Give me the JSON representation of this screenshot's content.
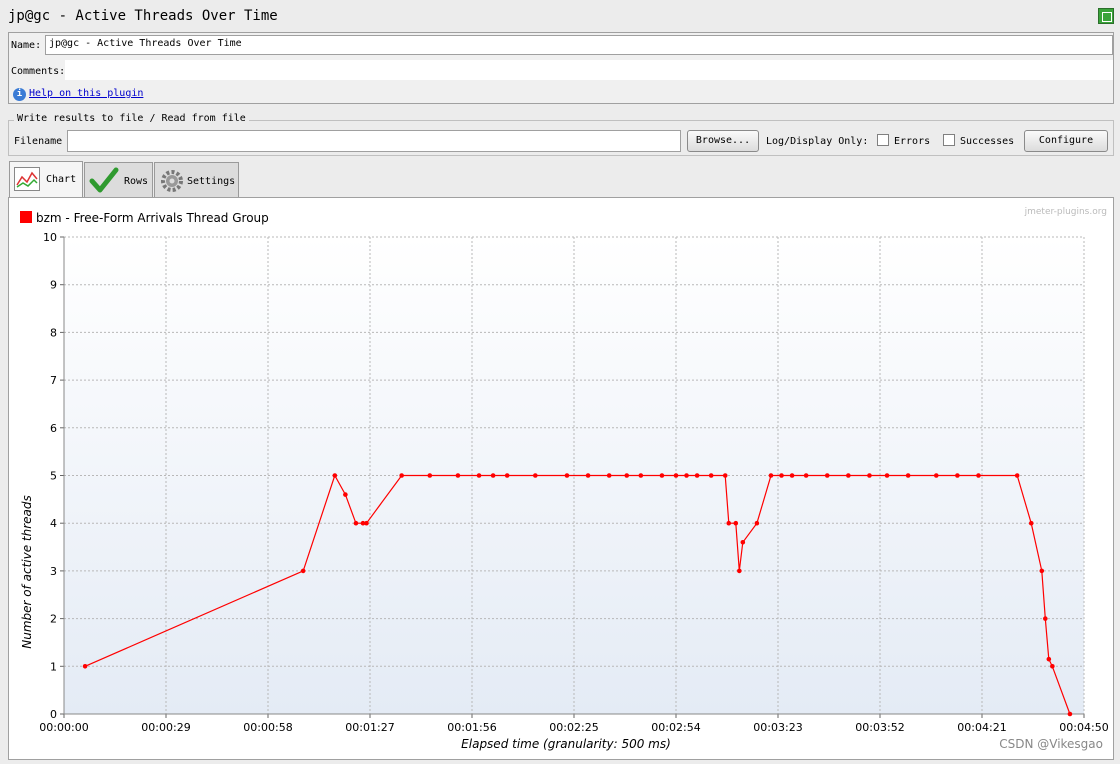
{
  "window": {
    "title": "jp@gc - Active Threads Over Time"
  },
  "form": {
    "name_label": "Name:",
    "name_value": "jp@gc - Active Threads Over Time",
    "comments_label": "Comments:",
    "comments_value": "",
    "help_link": "Help on this plugin"
  },
  "file": {
    "group_title": "Write results to file / Read from file",
    "filename_label": "Filename",
    "filename_value": "",
    "browse_button": "Browse...",
    "log_display_label": "Log/Display Only:",
    "errors_label": "Errors",
    "errors_checked": false,
    "successes_label": "Successes",
    "successes_checked": false,
    "configure_button": "Configure"
  },
  "tabs": [
    {
      "label": "Chart",
      "icon": "chart-icon",
      "active": true
    },
    {
      "label": "Rows",
      "icon": "checkmark-icon",
      "active": false
    },
    {
      "label": "Settings",
      "icon": "gear-icon",
      "active": false
    }
  ],
  "chart_data": {
    "type": "line",
    "legend_label": "bzm - Free-Form Arrivals Thread Group",
    "legend_placement": "top-left",
    "attribution": "jmeter-plugins.org",
    "xlabel": "Elapsed time (granularity: 500 ms)",
    "ylabel": "Number of active threads",
    "xlim": [
      "00:00:00",
      "00:04:50"
    ],
    "ylim": [
      0,
      10
    ],
    "x_ticks": [
      "00:00:00",
      "00:00:29",
      "00:00:58",
      "00:01:27",
      "00:01:56",
      "00:02:25",
      "00:02:54",
      "00:03:23",
      "00:03:52",
      "00:04:21",
      "00:04:50"
    ],
    "y_ticks": [
      0,
      1,
      2,
      3,
      4,
      5,
      6,
      7,
      8,
      9,
      10
    ],
    "grid": true,
    "series": [
      {
        "name": "bzm - Free-Form Arrivals Thread Group",
        "color": "#ff0000",
        "points": [
          {
            "x": "00:00:06",
            "y": 1
          },
          {
            "x": "00:01:08",
            "y": 3
          },
          {
            "x": "00:01:17",
            "y": 5
          },
          {
            "x": "00:01:20",
            "y": 4.6
          },
          {
            "x": "00:01:23",
            "y": 4
          },
          {
            "x": "00:01:25",
            "y": 4
          },
          {
            "x": "00:01:26",
            "y": 4
          },
          {
            "x": "00:01:36",
            "y": 5
          },
          {
            "x": "00:01:44",
            "y": 5
          },
          {
            "x": "00:01:52",
            "y": 5
          },
          {
            "x": "00:01:58",
            "y": 5
          },
          {
            "x": "00:02:02",
            "y": 5
          },
          {
            "x": "00:02:06",
            "y": 5
          },
          {
            "x": "00:02:14",
            "y": 5
          },
          {
            "x": "00:02:23",
            "y": 5
          },
          {
            "x": "00:02:29",
            "y": 5
          },
          {
            "x": "00:02:35",
            "y": 5
          },
          {
            "x": "00:02:40",
            "y": 5
          },
          {
            "x": "00:02:44",
            "y": 5
          },
          {
            "x": "00:02:50",
            "y": 5
          },
          {
            "x": "00:02:54",
            "y": 5
          },
          {
            "x": "00:02:57",
            "y": 5
          },
          {
            "x": "00:03:00",
            "y": 5
          },
          {
            "x": "00:03:04",
            "y": 5
          },
          {
            "x": "00:03:08",
            "y": 5
          },
          {
            "x": "00:03:09",
            "y": 4
          },
          {
            "x": "00:03:11",
            "y": 4
          },
          {
            "x": "00:03:12",
            "y": 3
          },
          {
            "x": "00:03:13",
            "y": 3.6
          },
          {
            "x": "00:03:17",
            "y": 4
          },
          {
            "x": "00:03:21",
            "y": 5
          },
          {
            "x": "00:03:24",
            "y": 5
          },
          {
            "x": "00:03:27",
            "y": 5
          },
          {
            "x": "00:03:31",
            "y": 5
          },
          {
            "x": "00:03:37",
            "y": 5
          },
          {
            "x": "00:03:43",
            "y": 5
          },
          {
            "x": "00:03:49",
            "y": 5
          },
          {
            "x": "00:03:54",
            "y": 5
          },
          {
            "x": "00:04:00",
            "y": 5
          },
          {
            "x": "00:04:08",
            "y": 5
          },
          {
            "x": "00:04:14",
            "y": 5
          },
          {
            "x": "00:04:20",
            "y": 5
          },
          {
            "x": "00:04:31",
            "y": 5
          },
          {
            "x": "00:04:35",
            "y": 4
          },
          {
            "x": "00:04:38",
            "y": 3
          },
          {
            "x": "00:04:39",
            "y": 2
          },
          {
            "x": "00:04:40",
            "y": 1.15
          },
          {
            "x": "00:04:41",
            "y": 1
          },
          {
            "x": "00:04:46",
            "y": 0
          }
        ]
      }
    ]
  },
  "footer": {
    "watermark": "CSDN @Vikesgao"
  }
}
